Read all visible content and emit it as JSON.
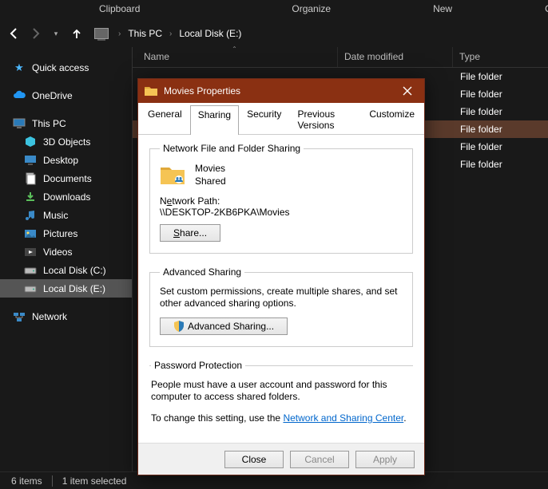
{
  "ribbon": {
    "clipboard": "Clipboard",
    "organize": "Organize",
    "new": "New",
    "open": "Open"
  },
  "breadcrumb": {
    "root": "This PC",
    "drive": "Local Disk (E:)"
  },
  "columns": {
    "name": "Name",
    "date": "Date modified",
    "type": "Type"
  },
  "tree": {
    "quick": "Quick access",
    "onedrive": "OneDrive",
    "thispc": "This PC",
    "d3": "3D Objects",
    "desktop": "Desktop",
    "documents": "Documents",
    "downloads": "Downloads",
    "music": "Music",
    "pictures": "Pictures",
    "videos": "Videos",
    "cdrive": "Local Disk (C:)",
    "edrive": "Local Disk (E:)",
    "network": "Network"
  },
  "rows": {
    "type": "File folder"
  },
  "dialog": {
    "title": "Movies Properties",
    "tabs": {
      "general": "General",
      "sharing": "Sharing",
      "security": "Security",
      "prev": "Previous Versions",
      "customize": "Customize"
    },
    "section1": {
      "legend": "Network File and Folder Sharing",
      "name": "Movies",
      "state": "Shared",
      "path_label_pre": "N",
      "path_label_u": "e",
      "path_label_post": "twork Path:",
      "path_value": "\\\\DESKTOP-2KB6PKA\\Movies",
      "share_btn": "Share..."
    },
    "section2": {
      "legend": "Advanced Sharing",
      "text": "Set custom permissions, create multiple shares, and set other advanced sharing options.",
      "btn": "Advanced Sharing..."
    },
    "section3": {
      "legend": "Password Protection",
      "text": "People must have a user account and password for this computer to access shared folders.",
      "change_pre": "To change this setting, use the ",
      "link": "Network and Sharing Center",
      "change_post": "."
    },
    "buttons": {
      "close": "Close",
      "cancel": "Cancel",
      "apply": "Apply"
    }
  },
  "status": {
    "items": "6 items",
    "selected": "1 item selected"
  }
}
